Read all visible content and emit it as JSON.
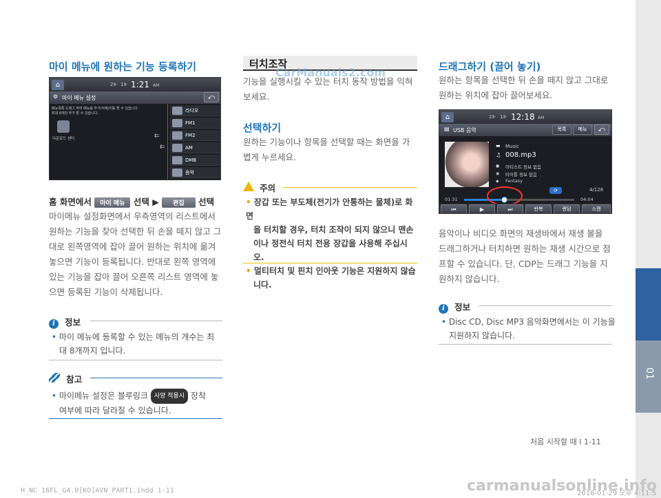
{
  "left": {
    "title": "마이 메뉴에 원하는 기능 등록하기",
    "screen": {
      "signal": "2⊪",
      "channel": "1⊪",
      "time": "1:21",
      "ampm": "AM",
      "header_label": "마이 메뉴 설정",
      "desc1": "메뉴목록 드래그 하여 메뉴를 추가/삭제/이동 할 수 있습니다.",
      "desc2": "최대 8개만 추가 할 수 있습니다.",
      "slot_label": "다운로드 센터",
      "menu": [
        "라디오",
        "FM1",
        "FM2",
        "AM",
        "DMB",
        "음악"
      ],
      "back": "⤺"
    },
    "step_prefix": "홈 화면에서",
    "btn_mymenu": "마이 메뉴",
    "step_select1": "선택 ▶",
    "btn_edit": "편집",
    "step_select2": "선택",
    "paragraph": [
      "마이메뉴 설정화면에서 우측영역의 리스트에서",
      "원하는 기능을 찾아 선택한 뒤 손을 떼지 않고 그",
      "대로 왼쪽영역에 잡아 끌어 원하는 위치에 옮겨",
      "놓으면 기능이 등록됩니다. 반대로 왼쪽 영역에",
      "있는 기능을 잡아 끌어 오른쪽 리스트 영역에 놓",
      "으면 등록된 기능이 삭제됩니다."
    ],
    "info": {
      "label": "정보",
      "bullet": "•",
      "line1": "마이 메뉴에 등록할 수 있는 메뉴의 개수는 최",
      "line2": "대 8개까지 입니다."
    },
    "note": {
      "label": "참고",
      "bullet": "•",
      "line1_a": "마이메뉴 설정은 블루링크",
      "pill": "사양 적용시",
      "line1_b": "장착",
      "line2": "여부에 따라 달라질 수 있습니다."
    }
  },
  "middle": {
    "title": "터치조작",
    "intro": [
      "기능을 실행시킬 수 있는 터치 동작 방법을 익혀",
      "보세요."
    ],
    "sub_title": "선택하기",
    "sub_text": [
      "원하는 기능이나 항목을 선택할 때는 화면을 가",
      "볍게 누르세요."
    ],
    "caution": {
      "label": "주의",
      "bullet": "•",
      "lines1": [
        "장갑 또는 부도체(전기가 안통하는 물체)로 화면",
        "을 터치할 경우, 터치 조작이 되지 않으니 맨손",
        "이나 정전식 터치 전용 장갑을 사용해 주십시오."
      ],
      "lines2": [
        "멀티터치 및 핀치 인아웃 기능은 지원하지 않습",
        "니다."
      ]
    }
  },
  "right": {
    "title": "드래그하기 (끌어 놓기)",
    "intro": [
      "원하는 항목을 선택한 뒤 손을 떼지 않고 그대로",
      "원하는 위치에 잡아 끌어보세요."
    ],
    "screen": {
      "signal": "2⊪",
      "channel": "1⊪",
      "time": "12:18",
      "ampm": "AM",
      "header_label": "USB 음악",
      "btn_list": "목록",
      "btn_menu": "메뉴",
      "back": "⤺",
      "folder": "Music",
      "file": "008.mp3",
      "artist": "아티스트 정보 없음",
      "title_info": "타이틀 정보 없음",
      "genre": "Fantasy",
      "track": "4/126",
      "elapsed": "01:31",
      "total": "04:04",
      "controls": [
        "⏮",
        "▶",
        "⏭",
        "반복",
        "랜덤",
        "스캔"
      ],
      "progress": 0.37
    },
    "paragraph": [
      "음악이나 비디오 화면의 재생바에서 재생 볼을",
      "드래그하거나 터치하면 원하는 재생 시간으로 점",
      "프할 수 있습니다. 단, CDP는 드래그 기능을 지",
      "원하지 않습니다."
    ],
    "info": {
      "label": "정보",
      "bullet": "•",
      "line1": "Disc CD, Disc MP3 음악화면에서는 이 기능을",
      "line2": "지원하지 않습니다."
    }
  },
  "footer": {
    "page_label": "처음 시작할 때 I 1-11",
    "file_info": "H_NC 16FL_G4.0[KO]AVN_PART1.indd   1-11",
    "date_info": "2016-01-29  오후 4:11:5",
    "watermark_top": "CarManuals2.com",
    "watermark_bottom": "carmanualsonline.info"
  },
  "side_tab": {
    "number": "01"
  }
}
